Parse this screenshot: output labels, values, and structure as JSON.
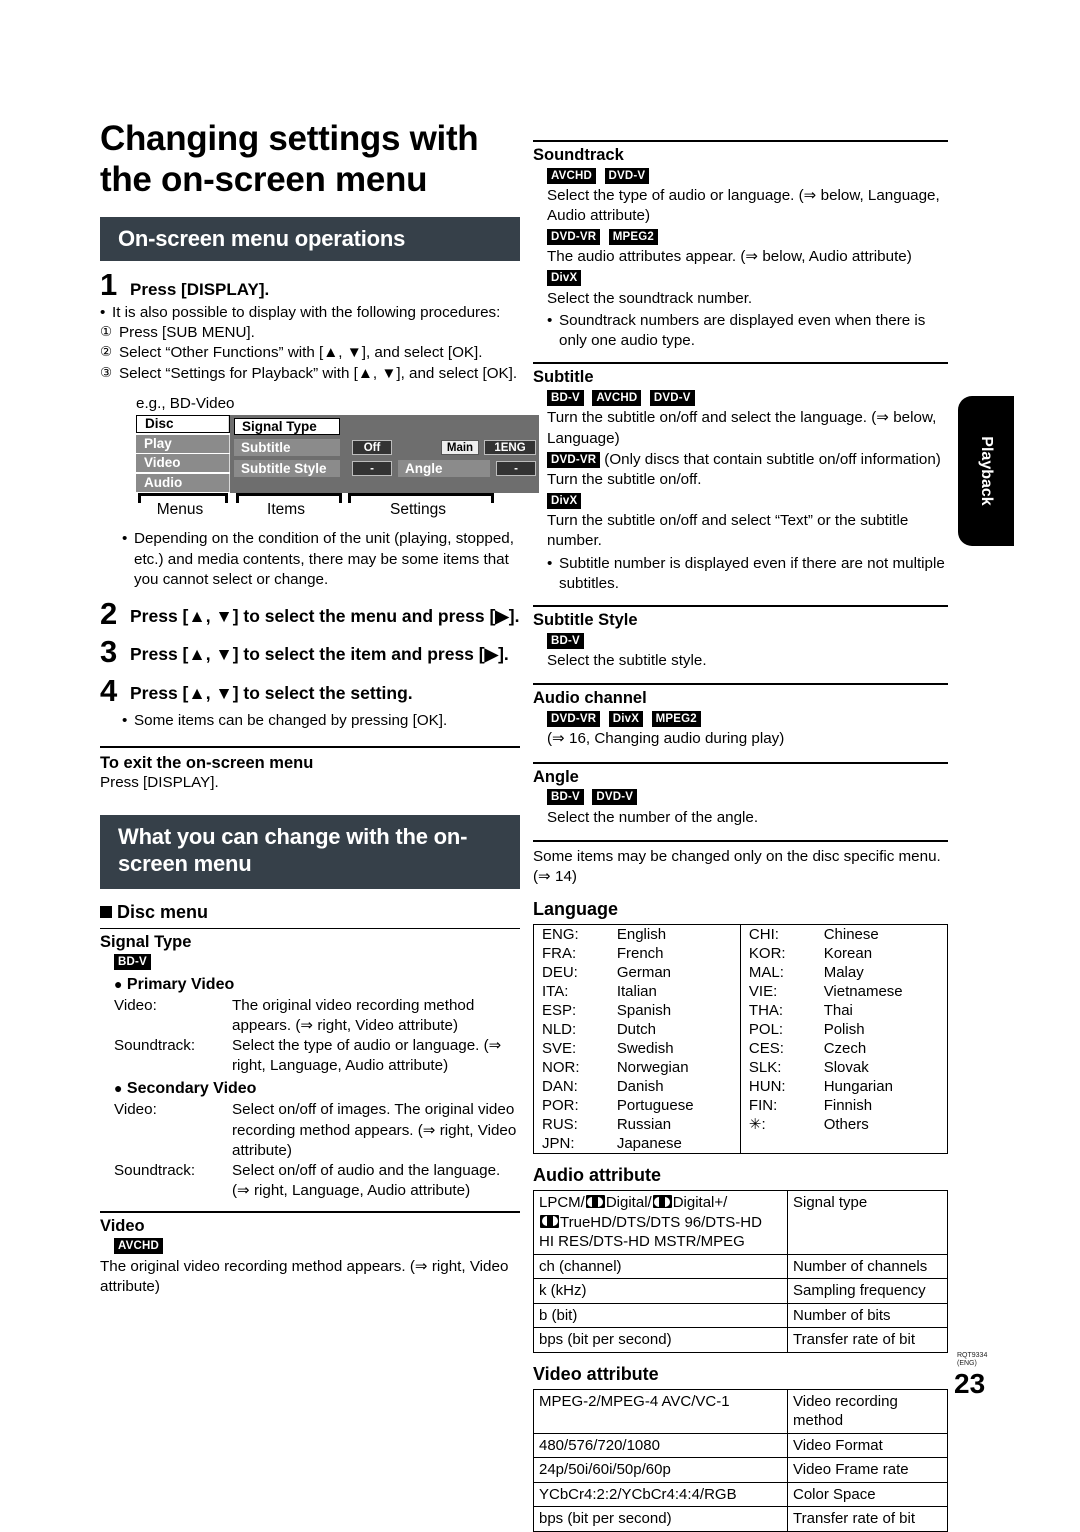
{
  "page": {
    "title": "Changing settings with the on-screen menu",
    "number": "23",
    "doc_code_line1": "RQT9334",
    "doc_code_line2": "(ENG)",
    "side_tab": "Playback"
  },
  "section1": {
    "bar": "On-screen menu operations",
    "step1": {
      "num": "1",
      "text": "Press [DISPLAY]."
    },
    "step1_bullet": "It is also possible to display with the following procedures:",
    "step1_substeps": [
      {
        "marker": "①",
        "text": "Press [SUB MENU]."
      },
      {
        "marker": "②",
        "text": "Select “Other Functions” with [▲, ▼], and select [OK]."
      },
      {
        "marker": "③",
        "text": "Select “Settings for Playback” with [▲, ▼], and select [OK]."
      }
    ],
    "figure": {
      "caption": "e.g., BD-Video",
      "menus": [
        "Disc",
        "Play",
        "Video",
        "Audio"
      ],
      "selected_menu": "Disc",
      "items": [
        "Signal Type",
        "Subtitle",
        "Subtitle Style"
      ],
      "settings": {
        "subtitle_off": "Off",
        "subtitle_main": "Main",
        "subtitle_lang": "1ENG",
        "subtitle_style_value": "-",
        "angle_label": "Angle",
        "angle_value": "-"
      },
      "brackets": [
        "Menus",
        "Items",
        "Settings"
      ]
    },
    "note_after_figure": "Depending on the condition of the unit (playing, stopped, etc.) and media contents, there may be some items that you cannot select or change.",
    "step2": {
      "num": "2",
      "text": "Press [▲, ▼] to select the menu and press [▶]."
    },
    "step3": {
      "num": "3",
      "text": "Press [▲, ▼] to select the item and press [▶]."
    },
    "step4": {
      "num": "4",
      "text": "Press [▲, ▼] to select the setting."
    },
    "step4_bullet": "Some items can be changed by pressing [OK].",
    "exit_heading": "To exit the on-screen menu",
    "exit_text": "Press [DISPLAY]."
  },
  "section2": {
    "bar": "What you can change with the on-screen menu",
    "disc_menu_heading": "Disc menu",
    "signal_type": {
      "heading": "Signal Type",
      "badges": [
        "BD-V"
      ],
      "primary_heading": "Primary Video",
      "primary_rows": [
        {
          "key": "Video:",
          "value": "The original video recording method appears. (⇒ right, Video attribute)"
        },
        {
          "key": "Soundtrack:",
          "value": "Select the type of audio or language. (⇒ right, Language, Audio attribute)"
        }
      ],
      "secondary_heading": "Secondary Video",
      "secondary_rows": [
        {
          "key": "Video:",
          "value": "Select on/off of images. The original video recording method appears. (⇒ right, Video attribute)"
        },
        {
          "key": "Soundtrack:",
          "value": "Select on/off of audio and the language. (⇒ right, Language, Audio attribute)"
        }
      ]
    },
    "video": {
      "heading": "Video",
      "badges": [
        "AVCHD"
      ],
      "text": "The original video recording method appears. (⇒ right, Video attribute)"
    }
  },
  "right": {
    "soundtrack": {
      "heading": "Soundtrack",
      "blocks": [
        {
          "badges": [
            "AVCHD",
            "DVD-V"
          ],
          "text": "Select the type of audio or language. (⇒ below, Language, Audio attribute)"
        },
        {
          "badges": [
            "DVD-VR",
            "MPEG2"
          ],
          "text": "The audio attributes appear. (⇒ below, Audio attribute)"
        },
        {
          "badges": [
            "DivX"
          ],
          "text": "Select the soundtrack number."
        }
      ],
      "bullet": "Soundtrack numbers are displayed even when there is only one audio type."
    },
    "subtitle": {
      "heading": "Subtitle",
      "blocks": [
        {
          "badges": [
            "BD-V",
            "AVCHD",
            "DVD-V"
          ],
          "text": "Turn the subtitle on/off and select the language. (⇒ below, Language)"
        },
        {
          "badges": [
            "DVD-VR"
          ],
          "inline": "(Only discs that contain subtitle on/off information)",
          "text": "Turn the subtitle on/off."
        },
        {
          "badges": [
            "DivX"
          ],
          "text": "Turn the subtitle on/off and select “Text” or the subtitle number."
        }
      ],
      "bullet": "Subtitle number is displayed even if there are not multiple subtitles."
    },
    "subtitle_style": {
      "heading": "Subtitle Style",
      "badges": [
        "BD-V"
      ],
      "text": "Select the subtitle style."
    },
    "audio_channel": {
      "heading": "Audio channel",
      "badges": [
        "DVD-VR",
        "DivX",
        "MPEG2"
      ],
      "text": "(⇒ 16, Changing audio during play)"
    },
    "angle": {
      "heading": "Angle",
      "badges": [
        "BD-V",
        "DVD-V"
      ],
      "text": "Select the number of the angle."
    },
    "footer_note": "Some items may be changed only on the disc specific menu. (⇒ 14)",
    "language": {
      "heading": "Language",
      "left_column": [
        {
          "code": "ENG:",
          "name": "English"
        },
        {
          "code": "FRA:",
          "name": "French"
        },
        {
          "code": "DEU:",
          "name": "German"
        },
        {
          "code": "ITA:",
          "name": "Italian"
        },
        {
          "code": "ESP:",
          "name": "Spanish"
        },
        {
          "code": "NLD:",
          "name": "Dutch"
        },
        {
          "code": "SVE:",
          "name": "Swedish"
        },
        {
          "code": "NOR:",
          "name": "Norwegian"
        },
        {
          "code": "DAN:",
          "name": "Danish"
        },
        {
          "code": "POR:",
          "name": "Portuguese"
        },
        {
          "code": "RUS:",
          "name": "Russian"
        },
        {
          "code": "JPN:",
          "name": "Japanese"
        }
      ],
      "right_column": [
        {
          "code": "CHI:",
          "name": "Chinese"
        },
        {
          "code": "KOR:",
          "name": "Korean"
        },
        {
          "code": "MAL:",
          "name": "Malay"
        },
        {
          "code": "VIE:",
          "name": "Vietnamese"
        },
        {
          "code": "THA:",
          "name": "Thai"
        },
        {
          "code": "POL:",
          "name": "Polish"
        },
        {
          "code": "CES:",
          "name": "Czech"
        },
        {
          "code": "SLK:",
          "name": "Slovak"
        },
        {
          "code": "HUN:",
          "name": "Hungarian"
        },
        {
          "code": "FIN:",
          "name": "Finnish"
        },
        {
          "code": "✳:",
          "name": "Others"
        },
        {
          "code": "",
          "name": ""
        }
      ]
    },
    "audio_attribute": {
      "heading": "Audio attribute",
      "rows": [
        {
          "left_pre": "LPCM/",
          "dolby": true,
          "left_rest": "Digital/",
          "dolby2": true,
          "left_rest2": "Digital+/",
          "left_line2_pre": "",
          "dolby3": true,
          "left_line2": "TrueHD/DTS/DTS 96/DTS-HD",
          "left_line3": "HI RES/DTS-HD MSTR/MPEG",
          "right": "Signal type"
        },
        {
          "left": "ch (channel)",
          "right": "Number of channels"
        },
        {
          "left": "k (kHz)",
          "right": "Sampling frequency"
        },
        {
          "left": "b (bit)",
          "right": "Number of bits"
        },
        {
          "left": "bps (bit per second)",
          "right": "Transfer rate of bit"
        }
      ]
    },
    "video_attribute": {
      "heading": "Video attribute",
      "rows": [
        {
          "left": "MPEG-2/MPEG-4 AVC/VC-1",
          "right": "Video recording method"
        },
        {
          "left": "480/576/720/1080",
          "right": "Video Format"
        },
        {
          "left": "24p/50i/60i/50p/60p",
          "right": "Video Frame rate"
        },
        {
          "left": "YCbCr4:2:2/YCbCr4:4:4/RGB",
          "right": "Color Space"
        },
        {
          "left": "bps (bit per second)",
          "right": "Transfer rate of bit"
        }
      ]
    }
  }
}
